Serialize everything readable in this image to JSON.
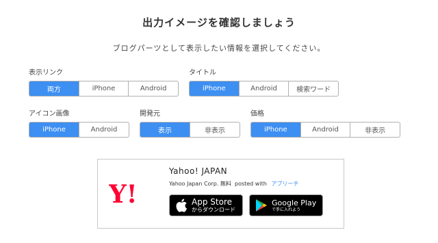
{
  "header": {
    "title": "出力イメージを確認しましょう",
    "subtitle": "ブログパーツとして表示したい情報を選択してください。"
  },
  "options": {
    "display_link": {
      "label": "表示リンク",
      "items": [
        "両方",
        "iPhone",
        "Android"
      ],
      "selected": "両方"
    },
    "title": {
      "label": "タイトル",
      "items": [
        "iPhone",
        "Android",
        "検索ワード"
      ],
      "selected": "iPhone"
    },
    "icon_image": {
      "label": "アイコン画像",
      "items": [
        "iPhone",
        "Android"
      ],
      "selected": "iPhone"
    },
    "developer": {
      "label": "開発元",
      "items": [
        "表示",
        "非表示"
      ],
      "selected": "表示"
    },
    "price": {
      "label": "価格",
      "items": [
        "iPhone",
        "Android",
        "非表示"
      ],
      "selected": "iPhone"
    }
  },
  "preview": {
    "app_name": "Yahoo! JAPAN",
    "developer": "Yahoo Japan Corp.",
    "price": "無料",
    "posted_with": "posted with",
    "posted_link": "アプリーチ",
    "app_store": {
      "big": "App Store",
      "small": "からダウンロード"
    },
    "google_play": {
      "big": "Google Play",
      "small": "で手に入れよう"
    },
    "logo_text": "Y!"
  },
  "colors": {
    "accent": "#3d8ff2",
    "logo_red": "#ff0033"
  }
}
